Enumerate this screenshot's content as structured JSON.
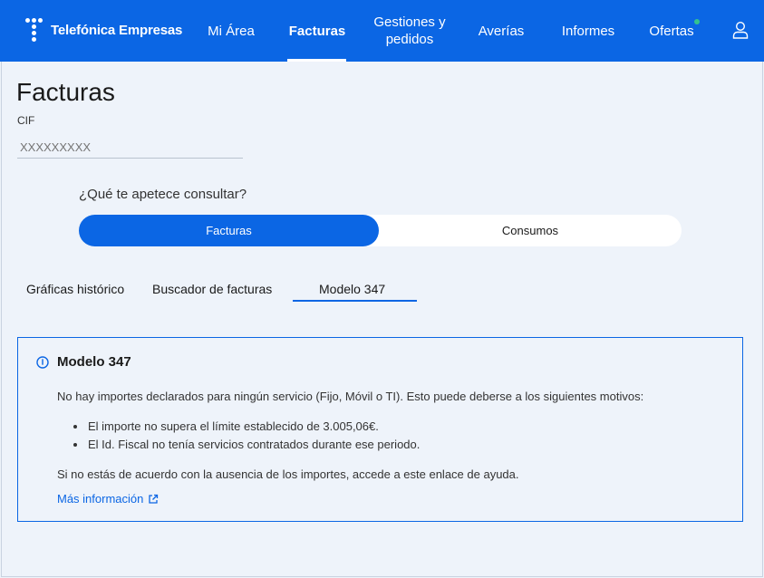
{
  "header": {
    "brand": "Telefónica Empresas",
    "nav": [
      {
        "label": "Mi Área"
      },
      {
        "label": "Facturas",
        "active": true
      },
      {
        "label": "Gestiones y pedidos"
      },
      {
        "label": "Averías"
      },
      {
        "label": "Informes"
      },
      {
        "label": "Ofertas",
        "badge": "notification-dot"
      }
    ],
    "user_icon": "user-icon",
    "colors": {
      "primary": "#0b66e4",
      "dot": "#34c38f"
    }
  },
  "page": {
    "title": "Facturas",
    "cif_label": "CIF",
    "cif_placeholder": "XXXXXXXXX"
  },
  "consult": {
    "question": "¿Qué te apetece consultar?",
    "options": [
      {
        "label": "Facturas",
        "selected": true
      },
      {
        "label": "Consumos",
        "selected": false
      }
    ]
  },
  "tabs": [
    {
      "label": "Gráficas histórico"
    },
    {
      "label": "Buscador de facturas"
    },
    {
      "label": "Modelo 347",
      "active": true
    }
  ],
  "card": {
    "icon": "info-icon",
    "title": "Modelo 347",
    "intro": "No hay importes declarados para ningún servicio (Fijo, Móvil o TI). Esto puede deberse a los siguientes motivos:",
    "reasons": [
      "El importe no supera el límite establecido de 3.005,06€.",
      "El Id. Fiscal no tenía servicios contratados durante ese periodo."
    ],
    "footer": "Si no estás de acuerdo con la ausencia de los importes, accede a este enlace de ayuda.",
    "link_label": "Más información",
    "link_icon": "external-link-icon"
  }
}
